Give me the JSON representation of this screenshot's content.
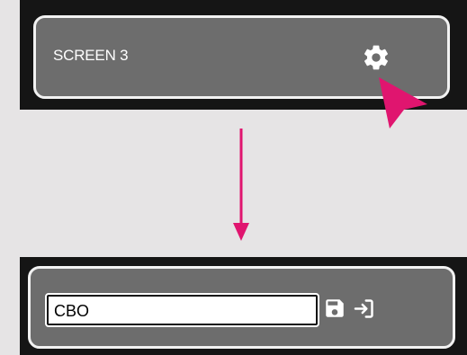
{
  "top_panel": {
    "title": "SCREEN 3",
    "settings_icon": "gear-icon"
  },
  "bottom_panel": {
    "name_input_value": "CBO",
    "save_icon": "save-icon",
    "exit_icon": "sign-in-icon"
  },
  "colors": {
    "page_background": "#e6e4e5",
    "panel_background": "#151515",
    "card_background": "#6d6d6d",
    "card_border": "#f2f2f2",
    "accent": "#e0156f"
  }
}
